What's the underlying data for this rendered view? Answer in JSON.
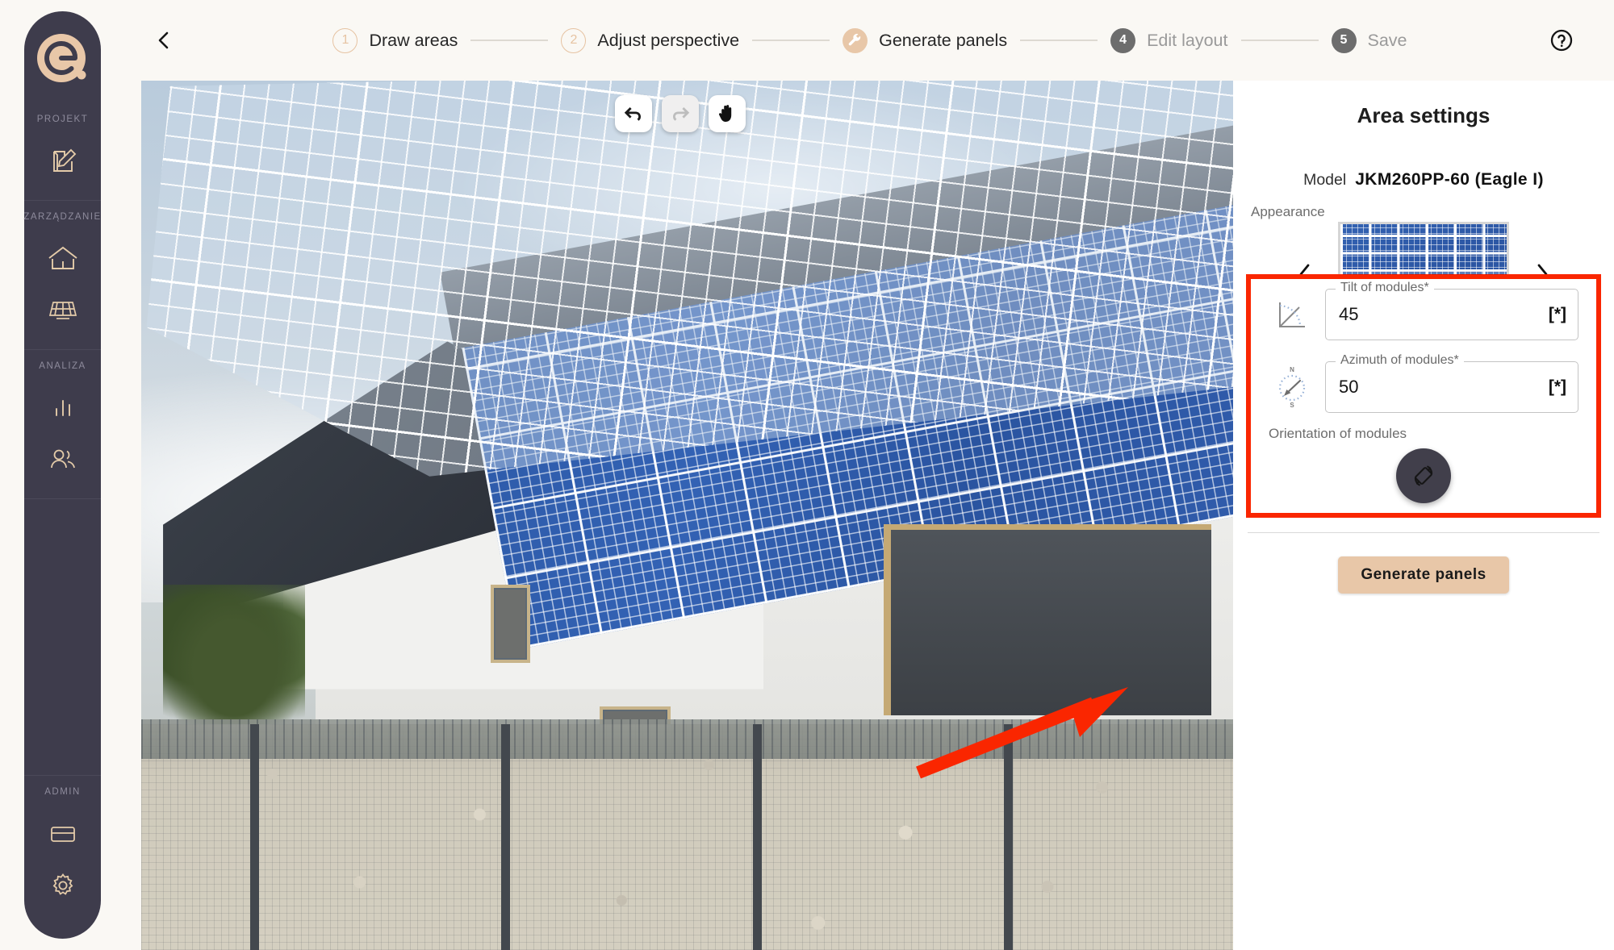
{
  "sidebar": {
    "logo_icon": "ecommerce-e-logo",
    "sections": [
      {
        "label": "PROJEKT",
        "items": [
          {
            "name": "project-edit",
            "icon": "edit-document-icon"
          }
        ]
      },
      {
        "label": "ZARZĄDZANIE",
        "items": [
          {
            "name": "buildings",
            "icon": "house-icon"
          },
          {
            "name": "panels",
            "icon": "solar-panel-icon"
          }
        ]
      },
      {
        "label": "ANALIZA",
        "items": [
          {
            "name": "statistics",
            "icon": "bar-chart-icon"
          },
          {
            "name": "users",
            "icon": "people-icon"
          }
        ]
      },
      {
        "label": "ADMIN",
        "items": [
          {
            "name": "billing",
            "icon": "credit-card-icon"
          },
          {
            "name": "settings",
            "icon": "gear-icon"
          }
        ]
      }
    ]
  },
  "header": {
    "back_icon": "chevron-left-icon",
    "help_icon": "help-circle-icon",
    "steps": [
      {
        "badge": "1",
        "label": "Draw areas",
        "state": "done",
        "badge_style": "ring"
      },
      {
        "badge": "2",
        "label": "Adjust perspective",
        "state": "done",
        "badge_style": "ring"
      },
      {
        "badge": "wrench-icon",
        "label": "Generate panels",
        "state": "current",
        "badge_style": "filled-tan"
      },
      {
        "badge": "4",
        "label": "Edit layout",
        "state": "pending",
        "badge_style": "filled-gray"
      },
      {
        "badge": "5",
        "label": "Save",
        "state": "pending",
        "badge_style": "filled-gray"
      }
    ]
  },
  "canvas": {
    "tools": [
      {
        "name": "undo",
        "icon": "undo-arrow-icon",
        "enabled": true
      },
      {
        "name": "redo",
        "icon": "redo-arrow-icon",
        "enabled": false
      },
      {
        "name": "pan",
        "icon": "hand-icon",
        "enabled": true
      }
    ],
    "zoom_controls": [
      {
        "name": "zoom-in",
        "icon": "plus-icon",
        "enabled": true
      },
      {
        "name": "zoom-out",
        "icon": "minus-icon",
        "enabled": false
      },
      {
        "name": "fit-to-screen",
        "icon": "expand-arrows-icon",
        "enabled": true
      }
    ]
  },
  "panel": {
    "title": "Area settings",
    "model_label": "Model",
    "model_value": "JKM260PP-60 (Eagle I)",
    "appearance_label": "Appearance",
    "prev_icon": "chevron-left-icon",
    "next_icon": "chevron-right-icon",
    "thumbnail_icon": "solar-panel-thumbnail",
    "tilt": {
      "legend": "Tilt of modules*",
      "value": "45",
      "unit": "[*]",
      "icon": "angle-tilt-icon"
    },
    "azimuth": {
      "legend": "Azimuth of modules*",
      "value": "50",
      "unit": "[*]",
      "icon": "compass-icon",
      "compass_north": "N",
      "compass_south": "S"
    },
    "orientation_label": "Orientation of modules",
    "orientation_icon": "screen-rotation-icon",
    "generate_button": "Generate panels"
  },
  "annotation": {
    "highlight_color": "#fa2600",
    "arrow_color": "#fa2600"
  },
  "colors": {
    "sidebar_bg": "#3e3c4c",
    "accent_tan": "#e8c7a8",
    "page_bg": "#faf8f4",
    "panel_bg": "#ffffff"
  }
}
